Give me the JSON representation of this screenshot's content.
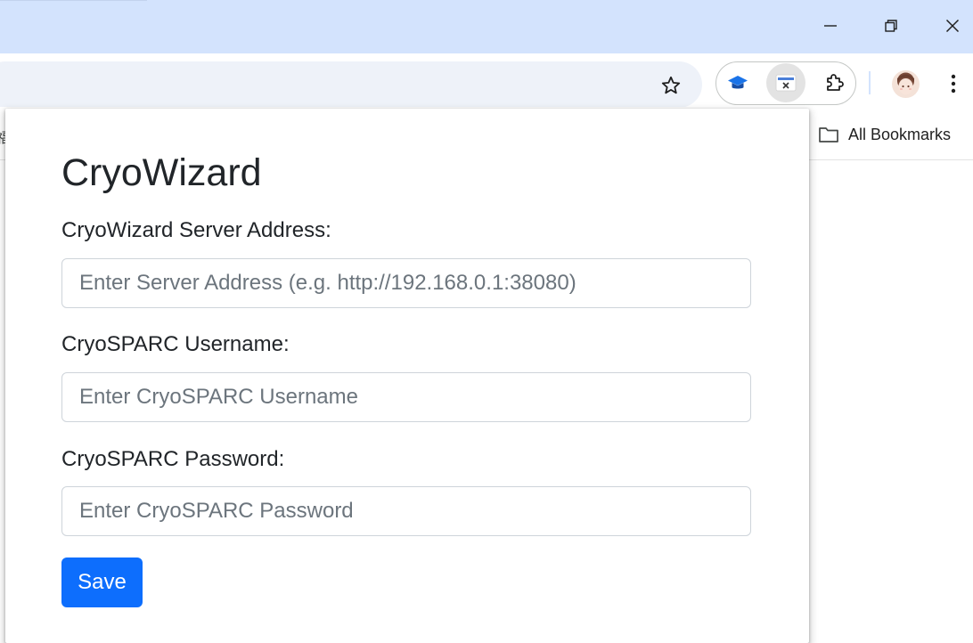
{
  "browser": {
    "bookmarks_bar": {
      "left_partial_glyph": "福",
      "all_bookmarks_label": "All Bookmarks"
    },
    "accent_color": "#d3e3fd"
  },
  "popup": {
    "title": "CryoWizard",
    "fields": [
      {
        "label": "CryoWizard Server Address:",
        "placeholder": "Enter Server Address (e.g. http://192.168.0.1:38080)",
        "value": ""
      },
      {
        "label": "CryoSPARC Username:",
        "placeholder": "Enter CryoSPARC Username",
        "value": ""
      },
      {
        "label": "CryoSPARC Password:",
        "placeholder": "Enter CryoSPARC Password",
        "value": ""
      }
    ],
    "save_label": "Save",
    "primary_color": "#0d6efd"
  }
}
